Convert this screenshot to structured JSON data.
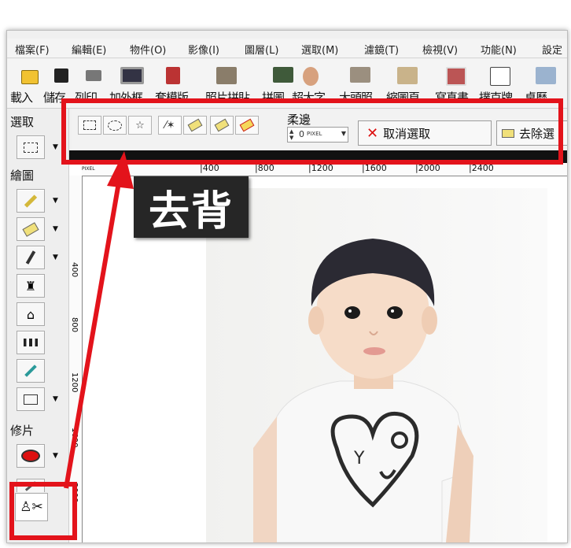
{
  "menubar": {
    "items": [
      "檔案(F)",
      "編輯(E)",
      "物件(O)",
      "影像(I)",
      "圖層(L)",
      "選取(M)",
      "濾鏡(T)",
      "檢視(V)",
      "功能(N)",
      "設定"
    ]
  },
  "toolbar": {
    "buttons": [
      "載入",
      "儲存",
      "列印",
      "加外框",
      "套模版",
      "照片拼貼",
      "拼圖",
      "超大字",
      "大頭照",
      "縮圖頁",
      "寫真書",
      "撲克牌",
      "桌曆"
    ]
  },
  "left_panel": {
    "select_title": "選取",
    "draw_title": "繪圖",
    "retouch_title": "修片"
  },
  "options_bar": {
    "soft_edge_label": "柔邊",
    "soft_edge_value": "0",
    "soft_edge_unit": "PIXEL",
    "deselect_label": "取消選取",
    "remove_bg_label": "去除選"
  },
  "ruler": {
    "top_ticks": [
      "|400",
      "|800",
      "|1200",
      "|1600",
      "|2000",
      "|2400"
    ],
    "top_origin": "PIXEL",
    "left_ticks": [
      "400",
      "800",
      "1200",
      "1600",
      "2000"
    ]
  },
  "callout": {
    "text": "去背"
  },
  "colors": {
    "highlight": "#e3131b",
    "callout_bg": "#262626"
  }
}
